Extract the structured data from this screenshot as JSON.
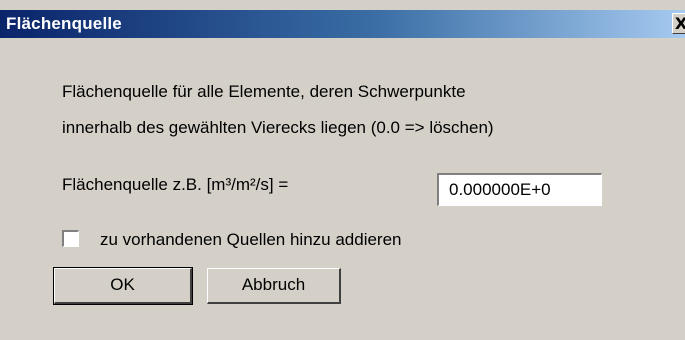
{
  "dialog": {
    "title": "Flächenquelle",
    "close_symbol": "X",
    "description_line1": "Flächenquelle für alle Elemente, deren Schwerpunkte",
    "description_line2": "innerhalb des gewählten Vierecks liegen (0.0 => löschen)",
    "field_label": "Flächenquelle z.B. [m³/m²/s] =",
    "field_value": "0.000000E+0",
    "checkbox_label": "zu vorhandenen Quellen hinzu addieren",
    "checkbox_checked": false,
    "ok_label": "OK",
    "cancel_label": "Abbruch"
  }
}
